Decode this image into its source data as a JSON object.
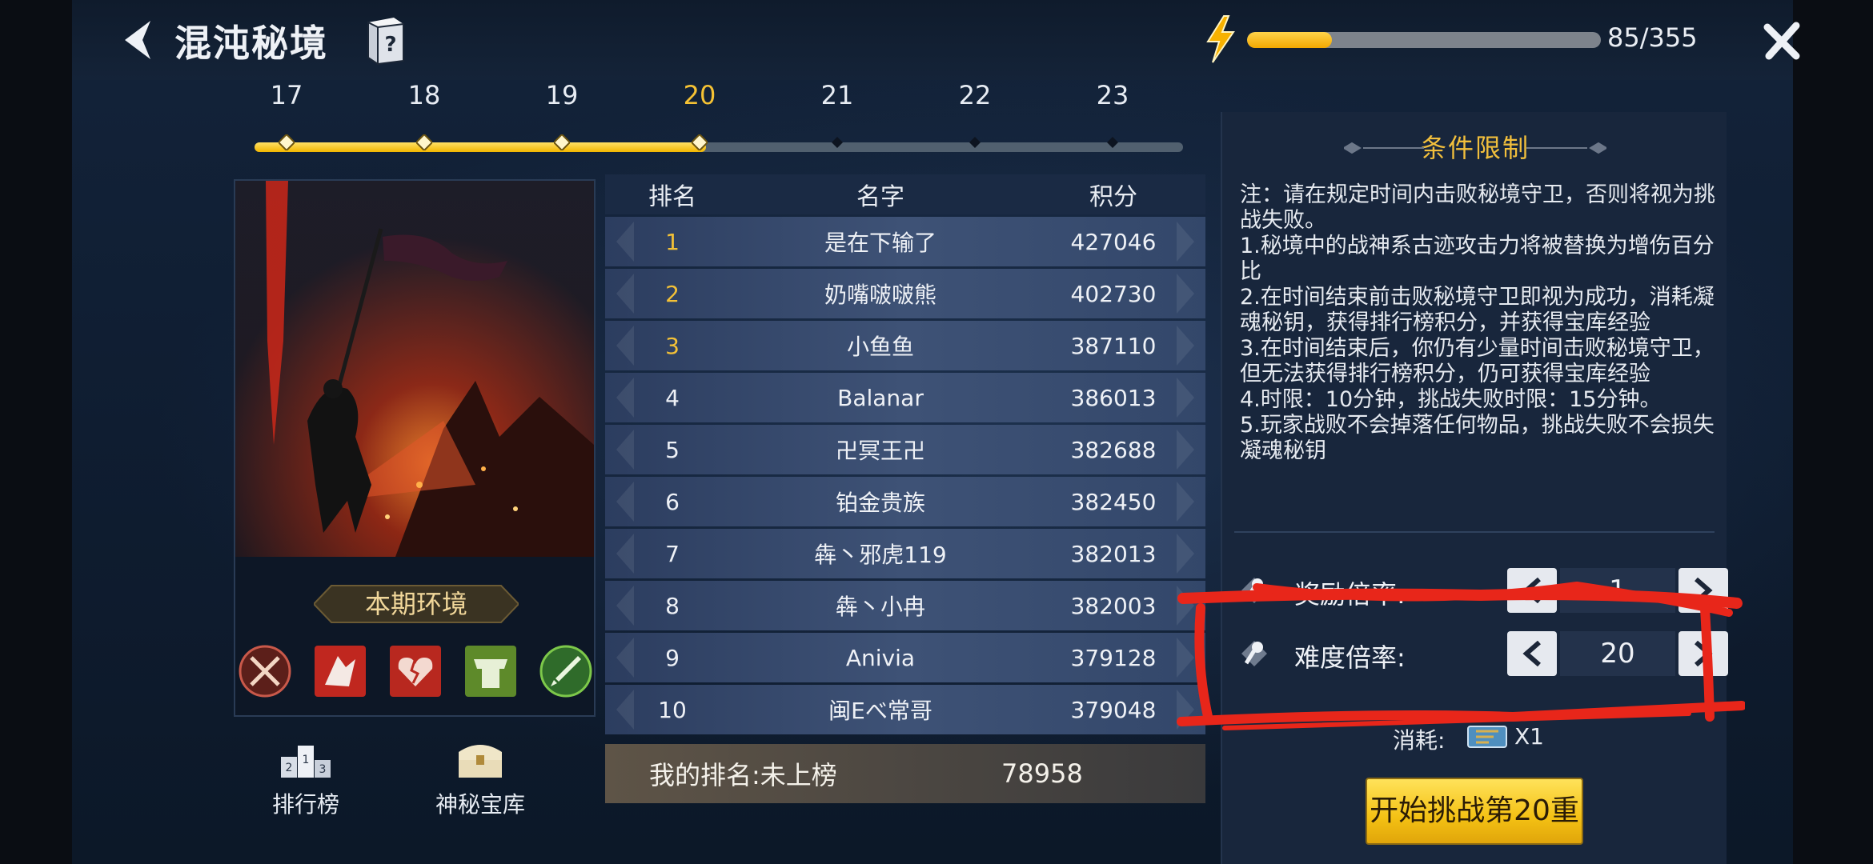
{
  "header": {
    "title": "混沌秘境",
    "energy_text": "85/355",
    "energy_fraction": 0.239
  },
  "levels": {
    "items": [
      "17",
      "18",
      "19",
      "20",
      "21",
      "22",
      "23"
    ],
    "active": "20"
  },
  "environment": {
    "label": "本期环境",
    "modifiers": [
      "cross-swords-icon",
      "broken-shield-icon",
      "heart-break-icon",
      "armor-icon",
      "sword-boost-icon"
    ]
  },
  "bottom_nav": {
    "leaderboard": "排行榜",
    "treasury": "神秘宝库"
  },
  "ranking": {
    "headers": {
      "rank": "排名",
      "name": "名字",
      "score": "积分"
    },
    "rows": [
      {
        "rank": "1",
        "name": "是在下输了",
        "score": "427046"
      },
      {
        "rank": "2",
        "name": "奶嘴啵啵熊",
        "score": "402730"
      },
      {
        "rank": "3",
        "name": "小鱼鱼",
        "score": "387110"
      },
      {
        "rank": "4",
        "name": "Balanar",
        "score": "386013"
      },
      {
        "rank": "5",
        "name": "卍冥王卍",
        "score": "382688"
      },
      {
        "rank": "6",
        "name": "铂金贵族",
        "score": "382450"
      },
      {
        "rank": "7",
        "name": "犇丶邪虎119",
        "score": "382013"
      },
      {
        "rank": "8",
        "name": "犇丶小冉",
        "score": "382003"
      },
      {
        "rank": "9",
        "name": "Anivia",
        "score": "379128"
      },
      {
        "rank": "10",
        "name": "闽Eべ常哥",
        "score": "379048"
      }
    ],
    "my_rank_label": "我的排名:未上榜",
    "my_score": "78958"
  },
  "conditions": {
    "title": "条件限制",
    "lines": [
      "注：请在规定时间内击败秘境守卫，否则将视为挑战失败。",
      "1.秘境中的战神系古迹攻击力将被替换为增伤百分比",
      "2.在时间结束前击败秘境守卫即视为成功，消耗凝魂秘钥，获得排行榜积分，并获得宝库经验",
      "3.在时间结束后，你仍有少量时间击败秘境守卫，但无法获得排行榜积分，仍可获得宝库经验",
      "4.时限：10分钟，挑战失败时限：15分钟。",
      "5.玩家战败不会掉落任何物品，挑战失败不会损失凝魂秘钥"
    ]
  },
  "multipliers": {
    "reward": {
      "label": "奖励倍率:",
      "value": "1"
    },
    "difficulty": {
      "label": "难度倍率:",
      "value": "20"
    }
  },
  "cost": {
    "label": "消耗:",
    "qty": "X1"
  },
  "start_button": "开始挑战第20重",
  "colors": {
    "accent_gold": "#f2bf3c",
    "energy_fill": "#f5b800",
    "start_button": "#f4c114",
    "annotation_red": "#e8261a"
  }
}
